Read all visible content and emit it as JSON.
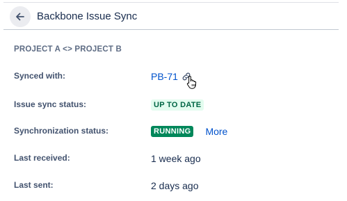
{
  "header": {
    "back_icon": "arrow-left-icon",
    "title": "Backbone Issue Sync"
  },
  "section": {
    "title": "PROJECT A <> PROJECT B"
  },
  "fields": {
    "synced_with": {
      "label": "Synced with:",
      "value": "PB-71",
      "icon": "link-icon"
    },
    "issue_sync_status": {
      "label": "Issue sync status:",
      "value": "UP TO DATE"
    },
    "synchronization_status": {
      "label": "Synchronization status:",
      "value": "RUNNING",
      "more": "More"
    },
    "last_received": {
      "label": "Last received:",
      "value": "1 week ago"
    },
    "last_sent": {
      "label": "Last sent:",
      "value": "2 days ago"
    }
  },
  "colors": {
    "link": "#0052cc",
    "success_bg": "#e3fcef",
    "success_text": "#006644",
    "running_bg": "#00875a"
  }
}
